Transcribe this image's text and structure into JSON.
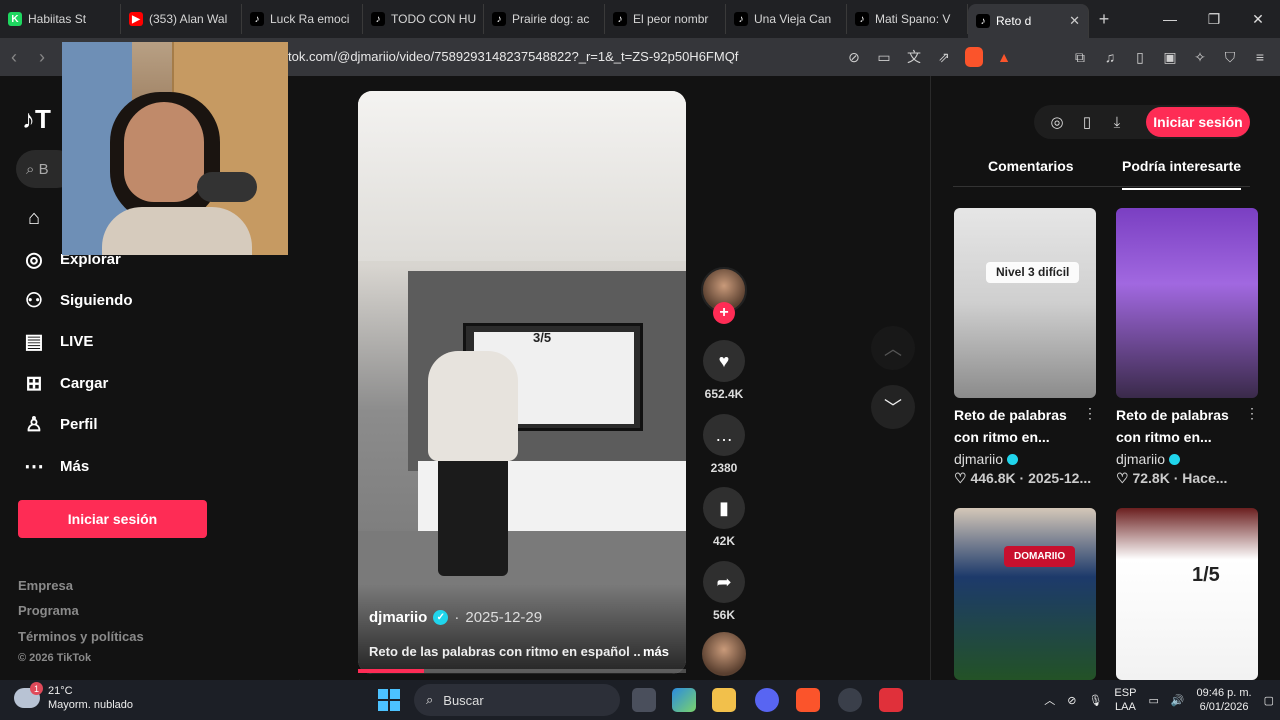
{
  "browser": {
    "tabs": [
      {
        "title": "Habiitas St",
        "favicon_color": "#1ed760",
        "favicon_glyph": "K",
        "active": false
      },
      {
        "title": "(353) Alan Wal",
        "favicon_color": "#ff0000",
        "favicon_glyph": "▶",
        "active": false
      },
      {
        "title": "Luck Ra emoci",
        "favicon_color": "#000000",
        "favicon_glyph": "♪",
        "active": false
      },
      {
        "title": "TODO CON HU",
        "favicon_color": "#000000",
        "favicon_glyph": "♪",
        "active": false
      },
      {
        "title": "Prairie dog: ac",
        "favicon_color": "#000000",
        "favicon_glyph": "♪",
        "active": false
      },
      {
        "title": "El peor nombr",
        "favicon_color": "#000000",
        "favicon_glyph": "♪",
        "active": false
      },
      {
        "title": "Una Vieja Can",
        "favicon_color": "#000000",
        "favicon_glyph": "♪",
        "active": false
      },
      {
        "title": "Mati Spano: V",
        "favicon_color": "#000000",
        "favicon_glyph": "♪",
        "active": false
      },
      {
        "title": "Reto d",
        "favicon_color": "#000000",
        "favicon_glyph": "♪",
        "active": true
      }
    ],
    "new_tab": "+",
    "url": "tok.com/@djmariio/video/7589293148237548822?_r=1&_t=ZS-92p50H6FMQf",
    "brave_badge": "1"
  },
  "sidebar": {
    "logo": "T",
    "search_placeholder": "B",
    "items": [
      {
        "label": "Explorar",
        "icon": "compass-icon"
      },
      {
        "label": "Siguiendo",
        "icon": "following-icon"
      },
      {
        "label": "LIVE",
        "icon": "live-icon"
      },
      {
        "label": "Cargar",
        "icon": "upload-icon"
      },
      {
        "label": "Perfil",
        "icon": "profile-icon"
      },
      {
        "label": "Más",
        "icon": "more-icon"
      }
    ],
    "login_button": "Iniciar sesión",
    "footer": [
      "Empresa",
      "Programa",
      "Términos y políticas"
    ],
    "copyright": "© 2026 TikTok"
  },
  "video": {
    "author": "djmariio",
    "date": "2025-12-29",
    "description": "Reto de las palabras con ritmo en español ..",
    "more": "más",
    "tv_counter": "3/5",
    "progress": 0.2,
    "likes": "652.4K",
    "comments": "2380",
    "saves": "42K",
    "shares": "56K"
  },
  "right_panel": {
    "login_button": "Iniciar sesión",
    "tabs": [
      "Comentarios",
      "Podría interesarte"
    ],
    "selected_tab": "Podría interesarte",
    "cards": [
      {
        "title": "Reto de palabras con ritmo en...",
        "author": "djmariio",
        "likes": "446.8K",
        "when": "2025-12...",
        "thumb_text": "Nivel 3 difícil"
      },
      {
        "title": "Reto de palabras con ritmo en...",
        "author": "djmariio",
        "likes": "72.8K",
        "when": "Hace...",
        "thumb_text": ""
      },
      {
        "title": "",
        "author": "",
        "likes": "",
        "when": "",
        "thumb_text": "DOMARIIO"
      },
      {
        "title": "",
        "author": "",
        "likes": "",
        "when": "",
        "thumb_text": "1/5"
      }
    ]
  },
  "taskbar": {
    "temp": "21°C",
    "weather": "Mayorm. nublado",
    "weather_badge": "1",
    "search": "Buscar",
    "lang1": "ESP",
    "lang2": "LAA",
    "time": "09:46 p. m.",
    "date": "6/01/2026"
  }
}
